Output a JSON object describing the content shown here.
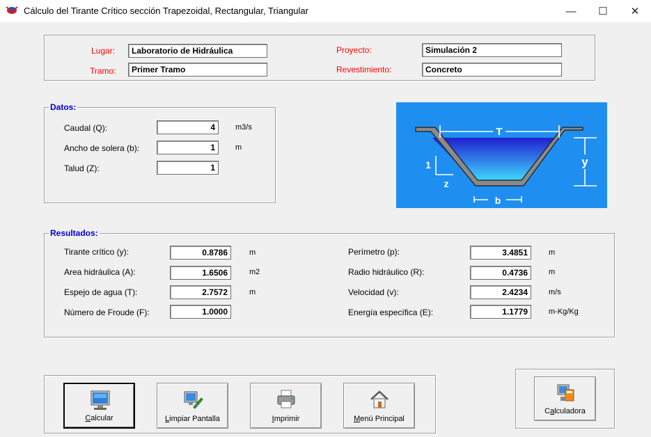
{
  "window": {
    "title": "Cálculo del Tirante Crítico sección Trapezoidal, Rectangular, Triangular",
    "minimize": "—",
    "maximize": "☐",
    "close": "✕"
  },
  "header": {
    "lugar_label": "Lugar:",
    "lugar_value": "Laboratorio de Hidráulica",
    "tramo_label": "Tramo:",
    "tramo_value": "Primer Tramo",
    "proyecto_label": "Proyecto:",
    "proyecto_value": "Simulación 2",
    "revestimiento_label": "Revestimiento:",
    "revestimiento_value": "Concreto"
  },
  "datos": {
    "title": "Datos:",
    "rows": [
      {
        "label": "Caudal (Q):",
        "value": "4",
        "unit": "m3/s"
      },
      {
        "label": "Ancho de solera (b):",
        "value": "1",
        "unit": "m"
      },
      {
        "label": "Talud (Z):",
        "value": "1",
        "unit": ""
      }
    ]
  },
  "diagram": {
    "T": "T",
    "y": "y",
    "one": "1",
    "z": "z",
    "b": "b"
  },
  "resultados": {
    "title": "Resultados:",
    "left": [
      {
        "label": "Tirante crítico (y):",
        "value": "0.8786",
        "unit": "m"
      },
      {
        "label": "Area hidráulica (A):",
        "value": "1.6506",
        "unit": "m2"
      },
      {
        "label": "Espejo de agua (T):",
        "value": "2.7572",
        "unit": "m"
      },
      {
        "label": "Número de Froude (F):",
        "value": "1.0000",
        "unit": ""
      }
    ],
    "right": [
      {
        "label": "Perímetro (p):",
        "value": "3.4851",
        "unit": "m"
      },
      {
        "label": "Radio hidráulico (R):",
        "value": "0.4736",
        "unit": "m"
      },
      {
        "label": "Velocidad (v):",
        "value": "2.4234",
        "unit": "m/s"
      },
      {
        "label": "Energía específica (E):",
        "value": "1.1779",
        "unit": "m-Kg/Kg"
      }
    ]
  },
  "buttons": {
    "calcular": {
      "u": "C",
      "rest": "alcular"
    },
    "limpiar": {
      "u": "L",
      "rest": "impiar Pantalla"
    },
    "imprimir": {
      "u": "I",
      "rest": "mprimir"
    },
    "menu": {
      "u": "M",
      "rest": "enú Principal"
    },
    "calculadora_pre": "C",
    "calculadora_u": "a",
    "calculadora_rest": "lculadora"
  }
}
